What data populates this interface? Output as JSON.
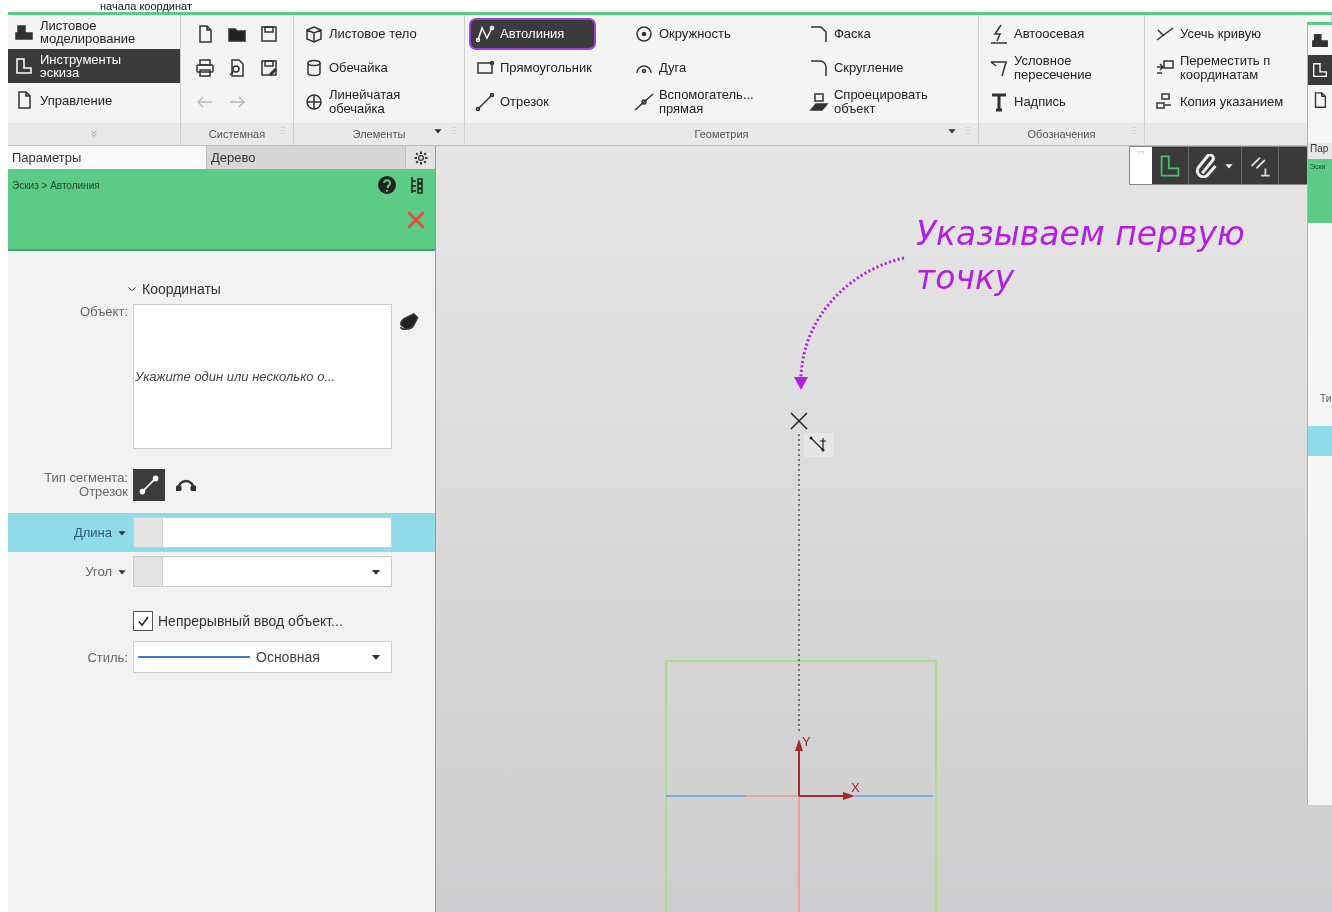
{
  "caption": "начала координат",
  "ribbon": {
    "modes": [
      {
        "label": "Листовое моделирование",
        "selected": false
      },
      {
        "label": "Инструменты эскиза",
        "selected": true
      },
      {
        "label": "Управление",
        "selected": false
      }
    ],
    "system": {
      "title": "Системная",
      "buttons": [
        {
          "disabled": false
        },
        {
          "disabled": false
        },
        {
          "disabled": false
        },
        {
          "disabled": false
        },
        {
          "disabled": false
        },
        {
          "disabled": false
        },
        {
          "disabled": true
        },
        {
          "disabled": true
        }
      ]
    },
    "groups": [
      {
        "title": "Элементы",
        "items": [
          {
            "label": "Листовое тело",
            "selected": false
          },
          {
            "label": "Обечайка",
            "selected": false
          },
          {
            "label": "Линейчатая обечайка",
            "selected": false
          }
        ]
      },
      {
        "title": "Геометрия",
        "items": [
          {
            "label": "Автолиния",
            "selected": true
          },
          {
            "label": "Прямоугольник",
            "selected": false
          },
          {
            "label": "Отрезок",
            "selected": false
          },
          {
            "label": "Окружность",
            "selected": false
          },
          {
            "label": "Дуга",
            "selected": false
          },
          {
            "label": "Вспомогатель... прямая",
            "selected": false
          },
          {
            "label": "Фаска",
            "selected": false
          },
          {
            "label": "Скругление",
            "selected": false
          },
          {
            "label": "Спроецировать объект",
            "selected": false
          }
        ]
      },
      {
        "title": "Обозначения",
        "items": [
          {
            "label": "Автоосевая",
            "selected": false
          },
          {
            "label": "Условное пересечение",
            "selected": false
          },
          {
            "label": "Надпись",
            "selected": false
          }
        ]
      },
      {
        "items": [
          {
            "label": "Усечь кривую",
            "selected": false
          },
          {
            "label": "Переместить п координатам",
            "selected": false
          },
          {
            "label": "Копия указанием",
            "selected": false
          }
        ]
      }
    ]
  },
  "panel": {
    "tabs": [
      {
        "label": "Параметры",
        "selected": true
      },
      {
        "label": "Дерево",
        "selected": false
      }
    ],
    "breadcrumb": "Эскиз > Автолиния",
    "section": {
      "title": "Координаты",
      "expanded": true
    },
    "object": {
      "label": "Объект:",
      "placeholder": "Укажите один или несколько о..."
    },
    "segment": {
      "label": "Тип сегмента:",
      "value": "Отрезок",
      "options": [
        {
          "kind": "line",
          "selected": true
        },
        {
          "kind": "arc",
          "selected": false
        }
      ]
    },
    "params": [
      {
        "label": "Длина",
        "highlighted": true,
        "dropdown": false
      },
      {
        "label": "Угол",
        "highlighted": false,
        "dropdown": true
      }
    ],
    "continuous": {
      "label": "Непрерывный ввод объект...",
      "checked": true
    },
    "style": {
      "label": "Стиль:",
      "value": "Основная"
    }
  },
  "canvas": {
    "annotation": "Указываем первую точку",
    "axis_y": "Y",
    "axis_x": "X"
  },
  "side_window": {
    "tab": "Пар",
    "breadcrumb": "Эски",
    "label": "Ти"
  }
}
